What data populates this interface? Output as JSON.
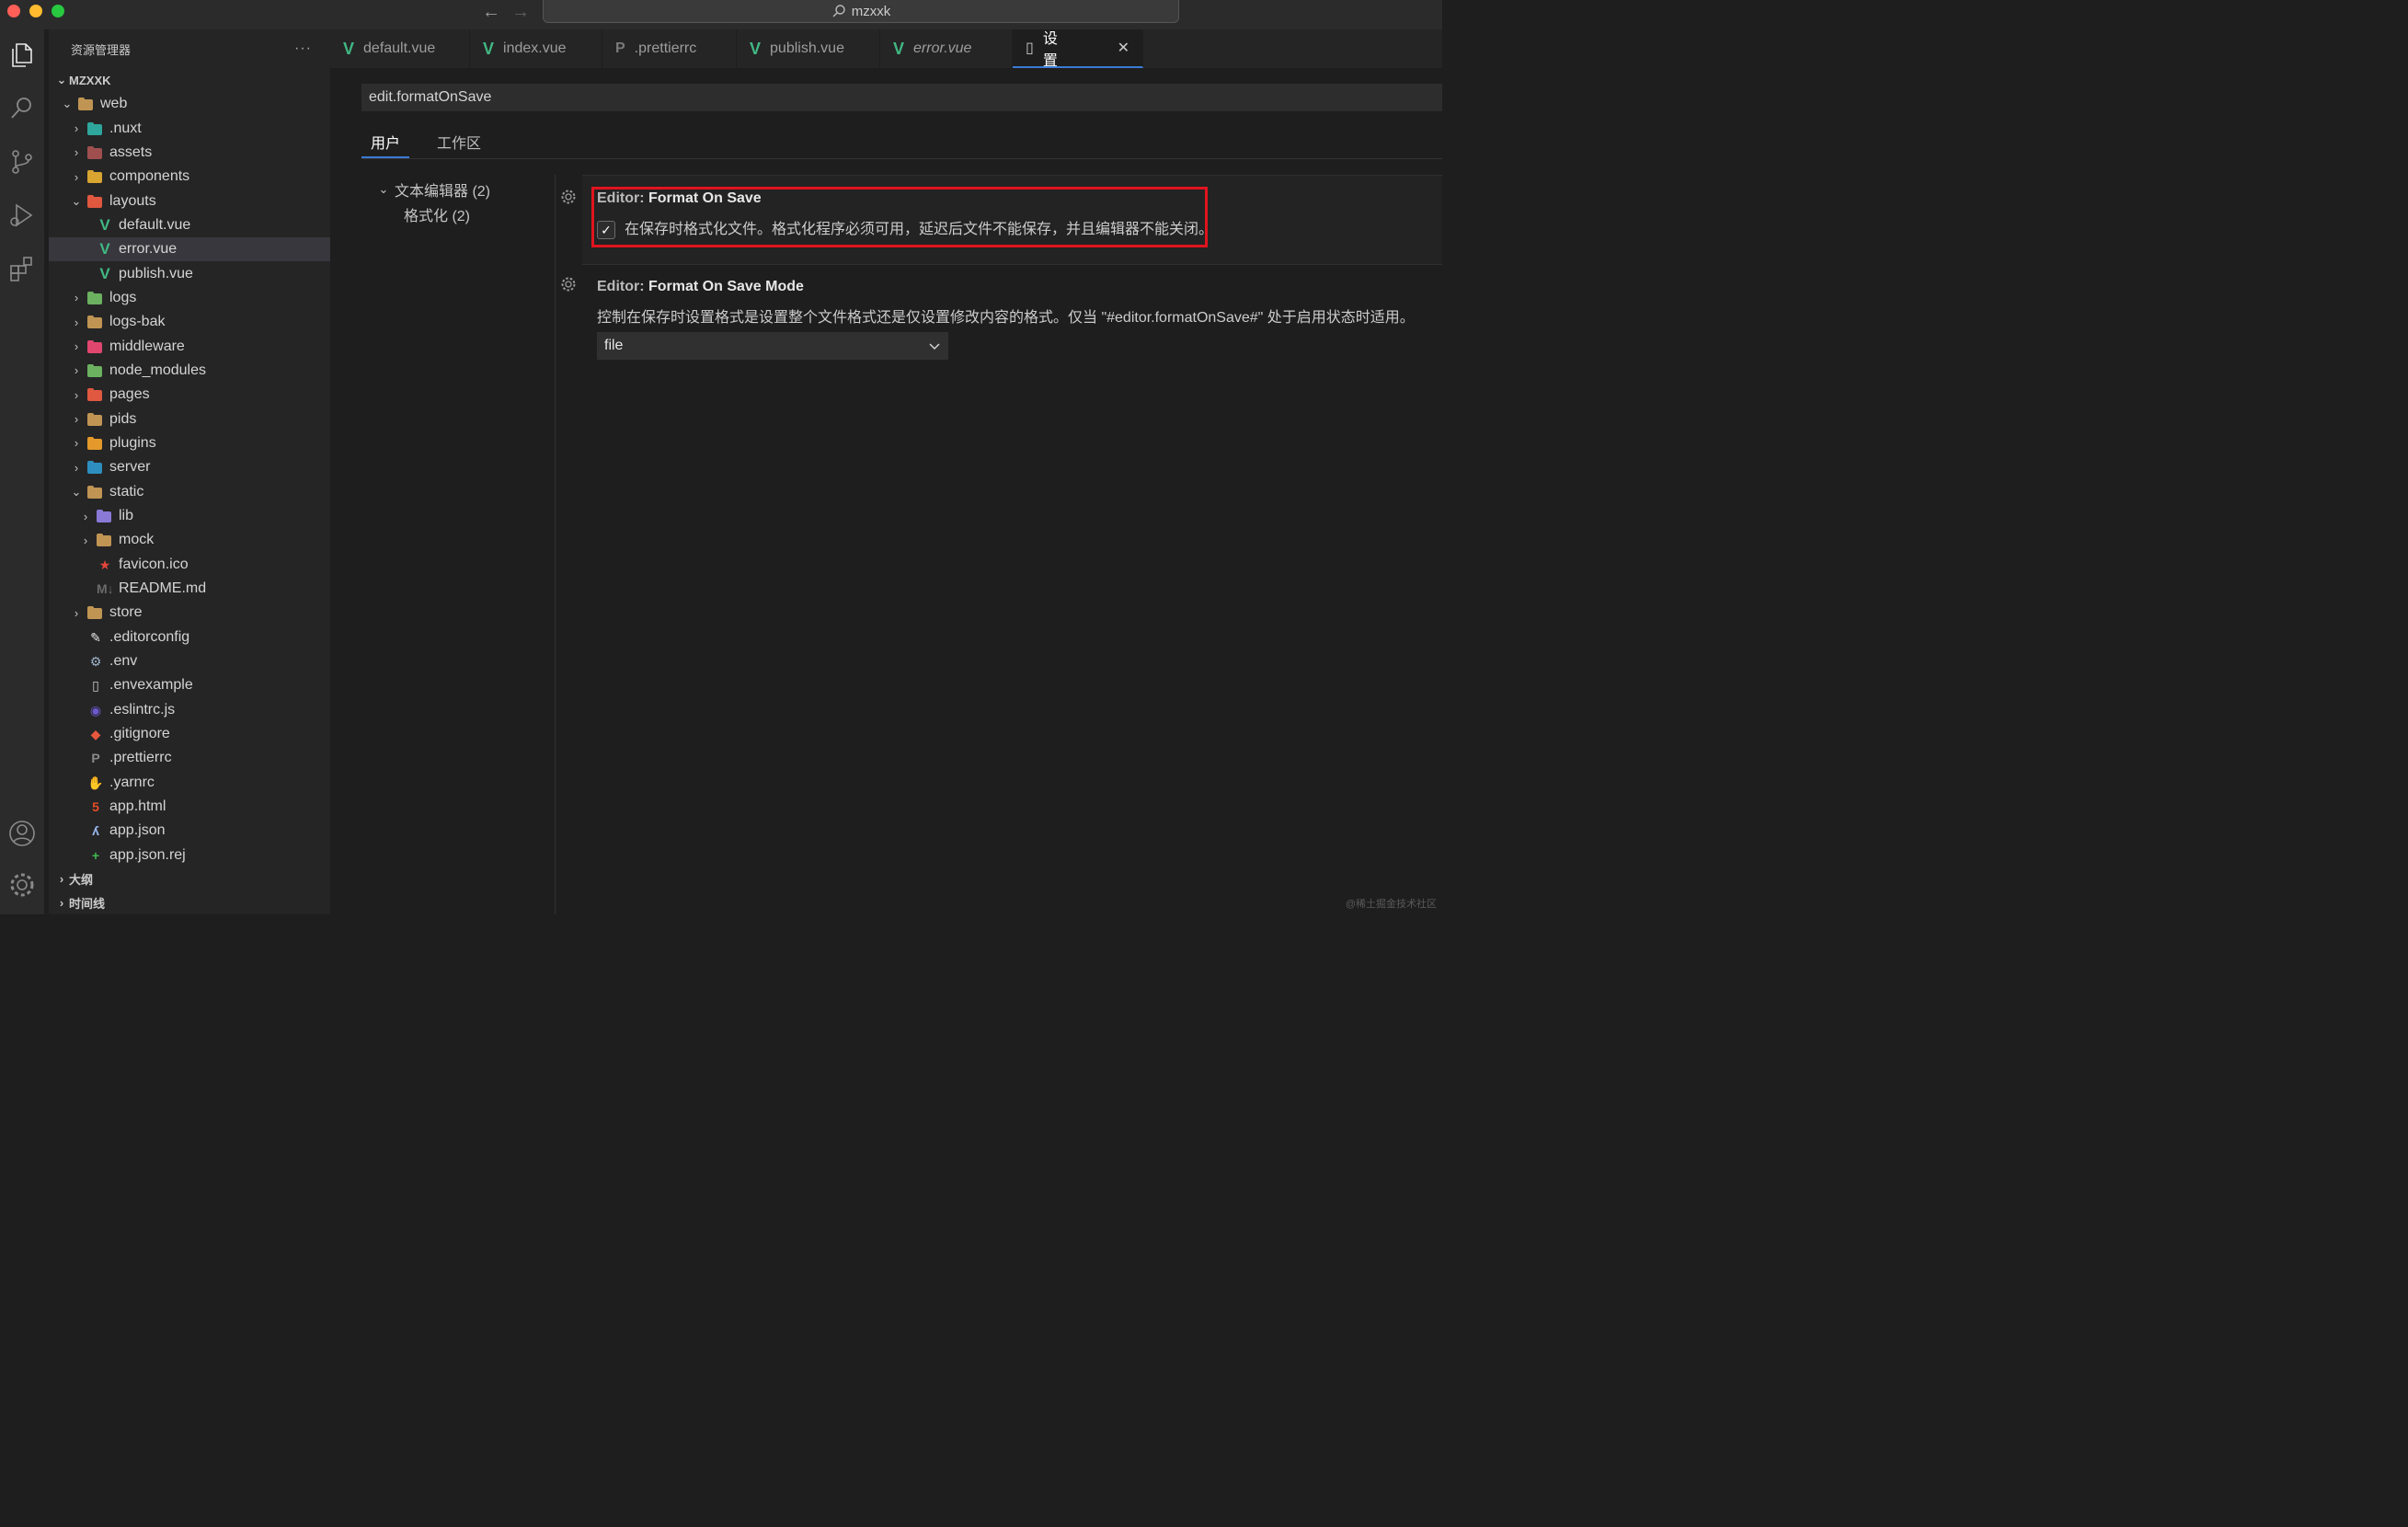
{
  "titlebar": {
    "search_text": "mzxxk"
  },
  "sidebar": {
    "title": "资源管理器",
    "more": "···",
    "root": "MZXXK",
    "tree": [
      {
        "label": "web",
        "level": 1,
        "kind": "folder-open",
        "chev": "⌄",
        "color": "#c09553",
        "icon": "folder-icon"
      },
      {
        "label": ".nuxt",
        "level": 2,
        "kind": "folder",
        "chev": "›",
        "color": "#2ea69b",
        "icon": "nuxt-folder-icon"
      },
      {
        "label": "assets",
        "level": 2,
        "kind": "folder",
        "chev": "›",
        "color": "#a04f4f",
        "icon": "assets-folder-icon"
      },
      {
        "label": "components",
        "level": 2,
        "kind": "folder",
        "chev": "›",
        "color": "#d8a531",
        "icon": "components-folder-icon"
      },
      {
        "label": "layouts",
        "level": 2,
        "kind": "folder-open",
        "chev": "⌄",
        "color": "#e0583f",
        "icon": "layouts-folder-icon"
      },
      {
        "label": "default.vue",
        "level": 3,
        "kind": "vue",
        "chev": "",
        "icon": "vue-file-icon"
      },
      {
        "label": "error.vue",
        "level": 3,
        "kind": "vue",
        "chev": "",
        "icon": "vue-file-icon",
        "selected": true
      },
      {
        "label": "publish.vue",
        "level": 3,
        "kind": "vue",
        "chev": "",
        "icon": "vue-file-icon"
      },
      {
        "label": "logs",
        "level": 2,
        "kind": "folder",
        "chev": "›",
        "color": "#6bb15f",
        "icon": "logs-folder-icon"
      },
      {
        "label": "logs-bak",
        "level": 2,
        "kind": "folder",
        "chev": "›",
        "color": "#c09553",
        "icon": "folder-icon"
      },
      {
        "label": "middleware",
        "level": 2,
        "kind": "folder",
        "chev": "›",
        "color": "#e0466e",
        "icon": "middleware-folder-icon"
      },
      {
        "label": "node_modules",
        "level": 2,
        "kind": "folder",
        "chev": "›",
        "color": "#6bb15f",
        "icon": "node-modules-folder-icon"
      },
      {
        "label": "pages",
        "level": 2,
        "kind": "folder",
        "chev": "›",
        "color": "#e0583f",
        "icon": "pages-folder-icon"
      },
      {
        "label": "pids",
        "level": 2,
        "kind": "folder",
        "chev": "›",
        "color": "#c09553",
        "icon": "folder-icon"
      },
      {
        "label": "plugins",
        "level": 2,
        "kind": "folder",
        "chev": "›",
        "color": "#e39a2a",
        "icon": "plugins-folder-icon"
      },
      {
        "label": "server",
        "level": 2,
        "kind": "folder",
        "chev": "›",
        "color": "#2e8fbf",
        "icon": "server-folder-icon"
      },
      {
        "label": "static",
        "level": 2,
        "kind": "folder-open",
        "chev": "⌄",
        "color": "#c09553",
        "icon": "folder-icon"
      },
      {
        "label": "lib",
        "level": 3,
        "kind": "folder",
        "chev": "›",
        "color": "#8a7ad6",
        "icon": "lib-folder-icon"
      },
      {
        "label": "mock",
        "level": 3,
        "kind": "folder",
        "chev": "›",
        "color": "#c09553",
        "icon": "folder-icon"
      },
      {
        "label": "favicon.ico",
        "level": 3,
        "kind": "file",
        "chev": "",
        "color": "#e8453c",
        "glyph": "★",
        "icon": "favicon-icon"
      },
      {
        "label": "README.md",
        "level": 3,
        "kind": "file",
        "chev": "",
        "color": "#6a6a6a",
        "glyph": "M↓",
        "icon": "markdown-icon"
      },
      {
        "label": "store",
        "level": 2,
        "kind": "folder",
        "chev": "›",
        "color": "#c09553",
        "icon": "folder-icon"
      },
      {
        "label": ".editorconfig",
        "level": 2,
        "kind": "file",
        "chev": "",
        "color": "#e7e7e7",
        "glyph": "✎",
        "icon": "editorconfig-icon"
      },
      {
        "label": ".env",
        "level": 2,
        "kind": "file",
        "chev": "",
        "color": "#9fb3c8",
        "glyph": "⚙",
        "icon": "env-gear-icon"
      },
      {
        "label": ".envexample",
        "level": 2,
        "kind": "file",
        "chev": "",
        "color": "#cccccc",
        "glyph": "▯",
        "icon": "file-icon"
      },
      {
        "label": ".eslintrc.js",
        "level": 2,
        "kind": "file",
        "chev": "",
        "color": "#6a5acd",
        "glyph": "◉",
        "icon": "eslint-icon"
      },
      {
        "label": ".gitignore",
        "level": 2,
        "kind": "file",
        "chev": "",
        "color": "#e8583f",
        "glyph": "◆",
        "icon": "git-icon"
      },
      {
        "label": ".prettierrc",
        "level": 2,
        "kind": "file",
        "chev": "",
        "color": "#8a8a8a",
        "glyph": "P",
        "icon": "prettier-icon"
      },
      {
        "label": ".yarnrc",
        "level": 2,
        "kind": "file",
        "chev": "",
        "color": "#2c8ebb",
        "glyph": "✋",
        "icon": "yarn-icon"
      },
      {
        "label": "app.html",
        "level": 2,
        "kind": "file",
        "chev": "",
        "color": "#e44d26",
        "glyph": "5",
        "icon": "html5-icon"
      },
      {
        "label": "app.json",
        "level": 2,
        "kind": "file",
        "chev": "",
        "color": "#9ab8f0",
        "glyph": "ʎ",
        "icon": "json-icon"
      },
      {
        "label": "app.json.rej",
        "level": 2,
        "kind": "file",
        "chev": "",
        "color": "#3fb950",
        "glyph": "+",
        "icon": "diff-icon"
      }
    ],
    "bottom": [
      {
        "label": "大纲"
      },
      {
        "label": "时间线"
      }
    ]
  },
  "tabs": [
    {
      "label": "default.vue",
      "icon": "vue-file-icon",
      "kind": "vue"
    },
    {
      "label": "index.vue",
      "icon": "vue-file-icon",
      "kind": "vue"
    },
    {
      "label": ".prettierrc",
      "icon": "prettier-icon",
      "kind": "prettier"
    },
    {
      "label": "publish.vue",
      "icon": "vue-file-icon",
      "kind": "vue"
    },
    {
      "label": "error.vue",
      "icon": "vue-file-icon",
      "kind": "vue",
      "italic": true
    },
    {
      "label": "设置",
      "icon": "file-icon",
      "kind": "settings",
      "active": true,
      "close": "✕"
    }
  ],
  "settings": {
    "search_value": "edit.formatOnSave",
    "scope_tabs": [
      {
        "label": "用户",
        "active": true
      },
      {
        "label": "工作区"
      }
    ],
    "toc": [
      {
        "label": "文本编辑器 (2)",
        "chev": "⌄"
      },
      {
        "label": "格式化 (2)"
      }
    ],
    "format_on_save": {
      "category": "Editor: ",
      "name": "Format On Save",
      "checked": true,
      "description": "在保存时格式化文件。格式化程序必须可用，延迟后文件不能保存，并且编辑器不能关闭。"
    },
    "format_on_save_mode": {
      "category": "Editor: ",
      "name": "Format On Save Mode",
      "description": "控制在保存时设置格式是设置整个文件格式还是仅设置修改内容的格式。仅当 \"#editor.formatOnSave#\" 处于启用状态时适用。",
      "value": "file"
    }
  },
  "watermark": "@稀土掘金技术社区",
  "colors": {
    "accent": "#3a7bd5",
    "highlight_box": "#e0141e",
    "vue_green": "#41b883"
  }
}
